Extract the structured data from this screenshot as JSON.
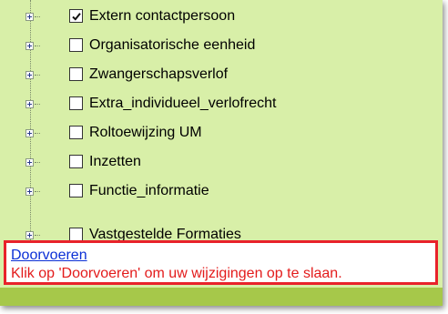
{
  "tree": {
    "items": [
      {
        "label": "Extern contactpersoon",
        "checked": true
      },
      {
        "label": "Organisatorische eenheid",
        "checked": false
      },
      {
        "label": "Zwangerschapsverlof",
        "checked": false
      },
      {
        "label": "Extra_individueel_verlofrecht",
        "checked": false
      },
      {
        "label": "Roltoewijzing UM",
        "checked": false
      },
      {
        "label": "Inzetten",
        "checked": false
      },
      {
        "label": "Functie_informatie",
        "checked": false
      },
      {
        "label": "Vastgestelde Formaties",
        "checked": false
      }
    ]
  },
  "message": {
    "link_label": "Doorvoeren",
    "text": "Klik op 'Doorvoeren' om uw wijzigingen op te slaan."
  },
  "colors": {
    "panel_background": "#d8efa8",
    "highlight_border": "#e8222a",
    "link": "#0b2fd6",
    "message_text": "#e31b1b",
    "bottom_strip": "#a6c84a"
  }
}
